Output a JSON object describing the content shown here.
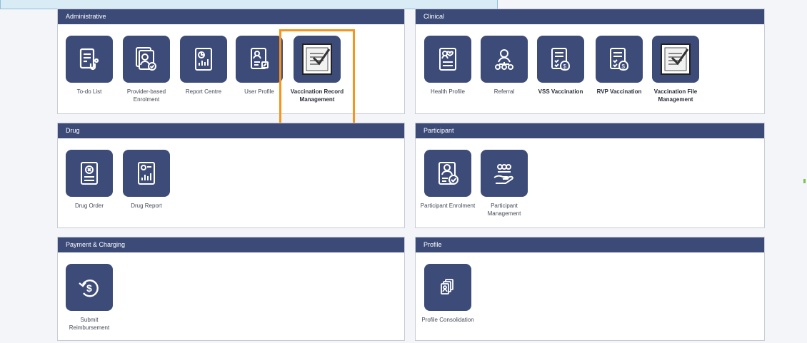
{
  "colors": {
    "header": "#3c4a78",
    "tile": "#3d4b79",
    "highlight": "#f7941d"
  },
  "panels": {
    "administrative": {
      "title": "Administrative",
      "tiles": [
        {
          "label": "To-do List",
          "icon": "todo-list-icon"
        },
        {
          "label": "Provider-based Enrolment",
          "icon": "provider-enrolment-icon"
        },
        {
          "label": "Report Centre",
          "icon": "report-centre-icon"
        },
        {
          "label": "User Profile",
          "icon": "user-profile-icon"
        },
        {
          "label": "Vaccination Record Management",
          "icon": "vaccination-record-icon"
        }
      ]
    },
    "clinical": {
      "title": "Clinical",
      "tiles": [
        {
          "label": "Health Profile",
          "icon": "health-profile-icon"
        },
        {
          "label": "Referral",
          "icon": "referral-icon"
        },
        {
          "label": "VSS Vaccination",
          "icon": "vss-vaccination-icon"
        },
        {
          "label": "RVP Vaccination",
          "icon": "rvp-vaccination-icon"
        },
        {
          "label": "Vaccination File Management",
          "icon": "vaccination-file-icon"
        }
      ]
    },
    "drug": {
      "title": "Drug",
      "tiles": [
        {
          "label": "Drug Order",
          "icon": "drug-order-icon"
        },
        {
          "label": "Drug Report",
          "icon": "drug-report-icon"
        }
      ]
    },
    "participant": {
      "title": "Participant",
      "tiles": [
        {
          "label": "Participant Enrolment",
          "icon": "participant-enrolment-icon"
        },
        {
          "label": "Participant Management",
          "icon": "participant-management-icon"
        }
      ]
    },
    "payment": {
      "title": "Payment & Charging",
      "tiles": [
        {
          "label": "Submit Reimbursement",
          "icon": "reimbursement-icon"
        }
      ]
    },
    "profile": {
      "title": "Profile",
      "tiles": [
        {
          "label": "Profile Consolidation",
          "icon": "profile-consolidation-icon"
        }
      ]
    }
  }
}
